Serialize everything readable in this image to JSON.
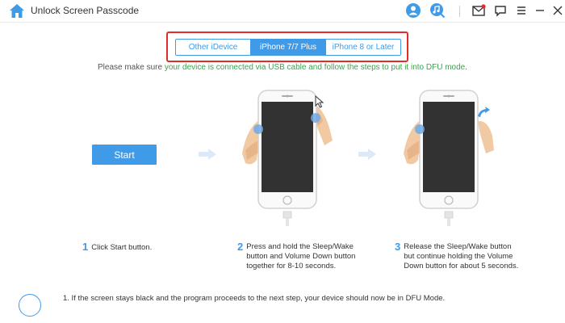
{
  "app": {
    "title": "Unlock Screen Passcode"
  },
  "header": {
    "icons": [
      "user-icon",
      "music-search-icon",
      "mail-icon",
      "feedback-icon",
      "menu-icon",
      "minimize-icon",
      "close-icon"
    ]
  },
  "tabs": [
    {
      "label": "Other iDevice",
      "active": false
    },
    {
      "label": "iPhone 7/7 Plus",
      "active": true
    },
    {
      "label": "iPhone 8 or Later",
      "active": false
    }
  ],
  "instruction": {
    "part1": "Please make sure ",
    "part2": "your device is connected via USB cable and follow the steps to put it into DFU mode",
    "part3": "."
  },
  "start_label": "Start",
  "steps": [
    {
      "num": "1",
      "text": "Click Start button."
    },
    {
      "num": "2",
      "text": "Press and hold the Sleep/Wake\nbutton and Volume Down button\ntogether for 8-10 seconds."
    },
    {
      "num": "3",
      "text": "Release the Sleep/Wake button\nbut continue holding the Volume\nDown button for about 5 seconds."
    }
  ],
  "note": "1. If the screen stays black and the program proceeds to the next step, your device should now be in DFU Mode.",
  "colors": {
    "accent": "#3f9ae8",
    "green": "#38a54a",
    "highlight": "#e32b2b"
  }
}
